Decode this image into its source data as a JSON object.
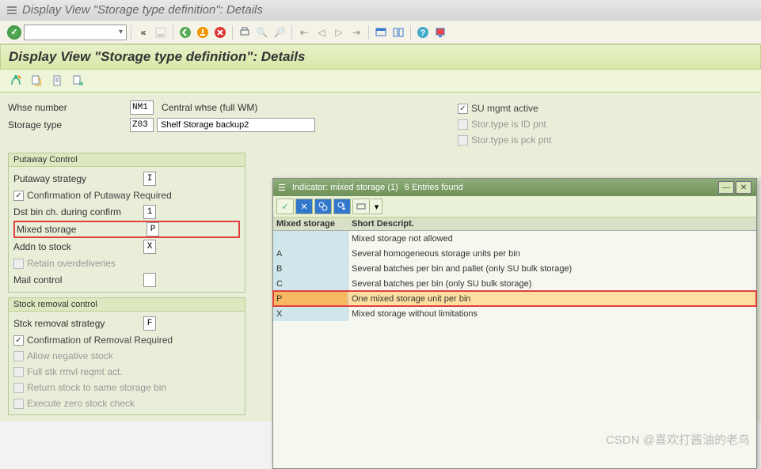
{
  "titlebar": {
    "title": "Display View \"Storage type definition\": Details"
  },
  "page_header": {
    "title": "Display View \"Storage type definition\": Details"
  },
  "fields": {
    "whse_number_label": "Whse number",
    "whse_number_value": "NM1",
    "whse_number_desc": "Central whse (full WM)",
    "storage_type_label": "Storage type",
    "storage_type_value": "Z03",
    "storage_type_desc": "Shelf Storage backup2"
  },
  "right_checks": {
    "su_mgmt": "SU mgmt active",
    "id_pnt": "Stor.type is ID pnt",
    "pck_pnt": "Stor.type is pck pnt"
  },
  "putaway": {
    "title": "Putaway Control",
    "strategy_label": "Putaway strategy",
    "strategy_value": "I",
    "confirm": "Confirmation of Putaway Required",
    "dst_bin_label": "Dst bin ch. during confirm",
    "dst_bin_value": "1",
    "mixed_label": "Mixed storage",
    "mixed_value": "P",
    "addn_label": "Addn to stock",
    "addn_value": "X",
    "retain": "Retain overdeliveries",
    "mail_label": "Mail control",
    "mail_value": ""
  },
  "removal": {
    "title": "Stock removal control",
    "strategy_label": "Stck removal strategy",
    "strategy_value": "F",
    "confirm": "Confirmation of Removal Required",
    "neg_stock": "Allow negative stock",
    "full_rmvl": "Full stk rmvl reqmt act.",
    "return_bin": "Return stock to same storage bin",
    "zero_check": "Execute zero stock check"
  },
  "popup": {
    "title": "Indicator: mixed storage (1)",
    "entries": "6 Entries found",
    "col1": "Mixed storage",
    "col2": "Short Descript.",
    "rows": [
      {
        "key": "",
        "desc": "Mixed storage not allowed",
        "selected": false
      },
      {
        "key": "A",
        "desc": "Several homogeneous storage units per bin",
        "selected": false
      },
      {
        "key": "B",
        "desc": "Several batches per bin and pallet (only SU bulk storage)",
        "selected": false
      },
      {
        "key": "C",
        "desc": "Several batches per bin (only SU bulk storage)",
        "selected": false
      },
      {
        "key": "P",
        "desc": "One mixed storage unit per bin",
        "selected": true
      },
      {
        "key": "X",
        "desc": "Mixed storage without limitations",
        "selected": false
      }
    ]
  },
  "watermark": "CSDN @喜欢打酱油的老鸟"
}
